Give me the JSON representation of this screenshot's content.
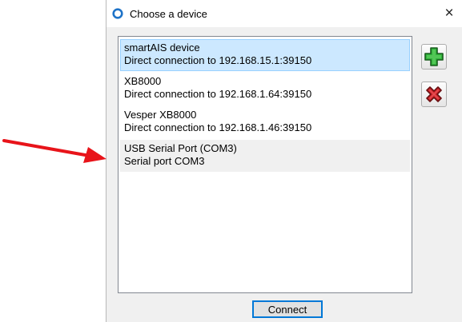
{
  "window": {
    "title": "Choose a device",
    "close_label": "×"
  },
  "devices": [
    {
      "name": "smartAIS device",
      "detail": "Direct connection to 192.168.15.1:39150",
      "state": "selected"
    },
    {
      "name": "XB8000",
      "detail": "Direct connection to 192.168.1.64:39150",
      "state": "normal"
    },
    {
      "name": "Vesper XB8000",
      "detail": "Direct connection to 192.168.1.46:39150",
      "state": "normal"
    },
    {
      "name": "USB Serial Port (COM3)",
      "detail": "Serial port COM3",
      "state": "hover"
    }
  ],
  "toolbar": {
    "add_icon": "green-plus-icon",
    "remove_icon": "red-x-icon"
  },
  "connect_label": "Connect",
  "annotation": {
    "arrow_color": "#e8141a",
    "arrow_target": "USB Serial Port (COM3)"
  },
  "colors": {
    "selection": "#cce8ff",
    "accent": "#0078d7"
  }
}
